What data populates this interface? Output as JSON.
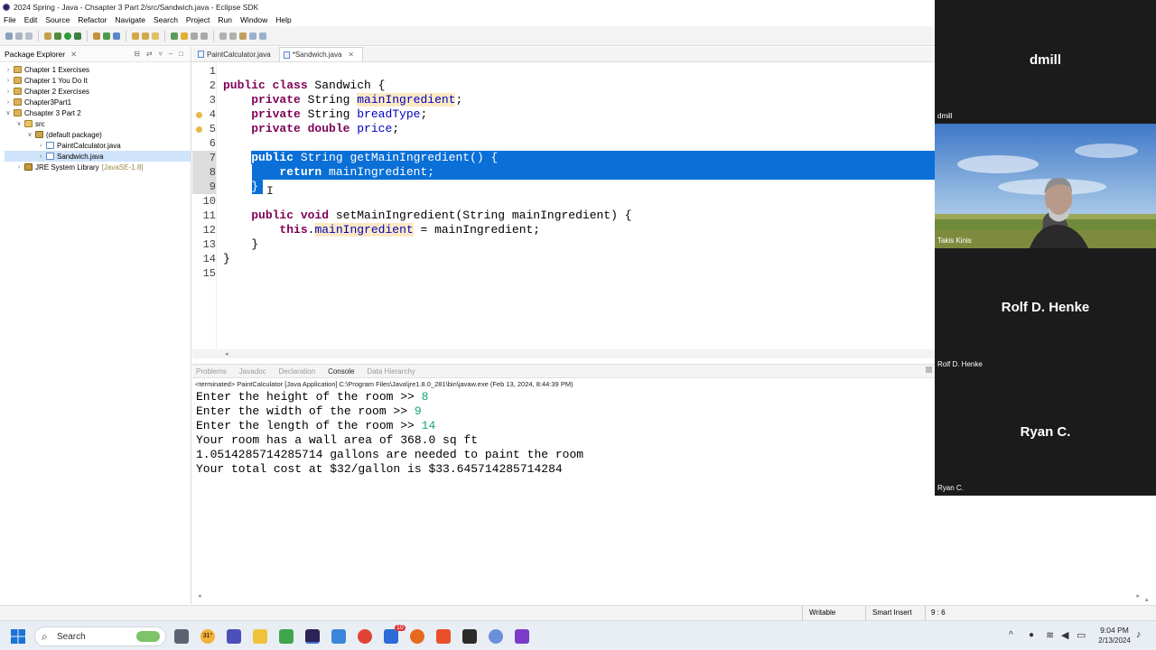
{
  "window": {
    "title": "2024 Spring - Java - Chsapter 3 Part 2/src/Sandwich.java - Eclipse SDK"
  },
  "menu": [
    "File",
    "Edit",
    "Source",
    "Refactor",
    "Navigate",
    "Search",
    "Project",
    "Run",
    "Window",
    "Help"
  ],
  "package_explorer": {
    "title": "Package Explorer",
    "items": [
      {
        "label": "Chapter 1 Exercises",
        "level": 0,
        "expanded": false,
        "type": "project"
      },
      {
        "label": "Chapter 1 You Do It",
        "level": 0,
        "expanded": false,
        "type": "project"
      },
      {
        "label": "Chapter 2 Exercises",
        "level": 0,
        "expanded": false,
        "type": "project"
      },
      {
        "label": "Chapter3Part1",
        "level": 0,
        "expanded": false,
        "type": "project"
      },
      {
        "label": "Chsapter 3 Part 2",
        "level": 0,
        "expanded": true,
        "type": "project"
      },
      {
        "label": "src",
        "level": 1,
        "expanded": true,
        "type": "src"
      },
      {
        "label": "(default package)",
        "level": 2,
        "expanded": true,
        "type": "package"
      },
      {
        "label": "PaintCalculator.java",
        "level": 3,
        "expanded": false,
        "type": "java"
      },
      {
        "label": "Sandwich.java",
        "level": 3,
        "expanded": false,
        "type": "java",
        "selected": true
      },
      {
        "label": "JRE System Library",
        "suffix": "[JavaSE-1.8]",
        "level": 1,
        "expanded": false,
        "type": "lib"
      }
    ]
  },
  "editor_tabs": [
    {
      "label": "PaintCalculator.java",
      "active": false
    },
    {
      "label": "*Sandwich.java",
      "active": true
    }
  ],
  "code_lines": [
    {
      "n": "1",
      "html": ""
    },
    {
      "n": "2",
      "html": "<span class=\"kw\">public class</span> Sandwich {"
    },
    {
      "n": "3",
      "html": "    <span class=\"kw\">private</span> String <span class=\"fld hlw\">mainIngredient</span>;"
    },
    {
      "n": "4",
      "html": "    <span class=\"kw\">private</span> String <span class=\"fld\">breadType</span>;"
    },
    {
      "n": "5",
      "html": "    <span class=\"kw\">private double</span> <span class=\"fld\">price</span>;"
    },
    {
      "n": "6",
      "html": ""
    },
    {
      "n": "7",
      "html": "    <span class=\"sel\"><span class=\"kw\">public</span> String getMainIngredient() {</span>",
      "selrow": true
    },
    {
      "n": "8",
      "html": "        <span class=\"kw\">return</span> <span class=\"fld\">mainIngredient</span>;",
      "selrow": true
    },
    {
      "n": "9",
      "html": "    }",
      "selpart": true
    },
    {
      "n": "10",
      "html": ""
    },
    {
      "n": "11",
      "html": "    <span class=\"kw\">public void</span> setMainIngredient(String mainIngredient) {"
    },
    {
      "n": "12",
      "html": "        <span class=\"kw\">this</span>.<span class=\"fld hlw\">mainIngredient</span> = mainIngredient;"
    },
    {
      "n": "13",
      "html": "    }"
    },
    {
      "n": "14",
      "html": "}"
    },
    {
      "n": "15",
      "html": ""
    }
  ],
  "console_tabs": [
    "Problems",
    "Javadoc",
    "Declaration",
    "Console",
    "Data Hierarchy"
  ],
  "console": {
    "header": "<terminated> PaintCalculator [Java Application] C:\\Program Files\\Java\\jre1.8.0_281\\bin\\javaw.exe (Feb 13, 2024, 8:44:39 PM)",
    "lines": [
      {
        "text": "Enter the height of the room >> ",
        "input": "8"
      },
      {
        "text": "Enter the width of the room >> ",
        "input": "9"
      },
      {
        "text": "Enter the length of the room >> ",
        "input": "14"
      },
      {
        "text": "Your room has a wall area of 368.0 sq ft",
        "input": ""
      },
      {
        "text": "1.0514285714285714 gallons are needed to paint the room",
        "input": ""
      },
      {
        "text": "Your total cost at $32/gallon is $33.645714285714284",
        "input": ""
      }
    ]
  },
  "status": {
    "writable": "Writable",
    "insert": "Smart Insert",
    "position": "9 : 6"
  },
  "zoom": {
    "participants": [
      {
        "name": "dmill",
        "label": "dmill",
        "video": false
      },
      {
        "name": "",
        "label": "Takis Kinis",
        "video": true
      },
      {
        "name": "Rolf D. Henke",
        "label": "Rolf D. Henke",
        "video": false
      },
      {
        "name": "Ryan C.",
        "label": "Ryan C.",
        "video": false
      }
    ]
  },
  "taskbar": {
    "search": "Search",
    "time": "9:04 PM",
    "date": "2/13/2024",
    "temp": "31°",
    "badge": "10"
  }
}
